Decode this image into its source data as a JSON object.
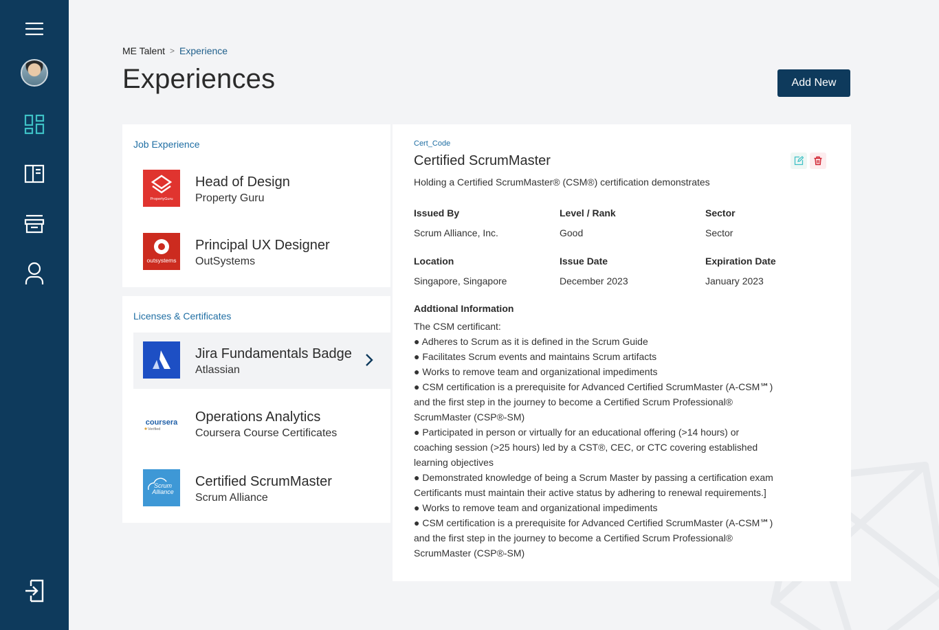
{
  "breadcrumb": {
    "root": "ME Talent",
    "separator": ">",
    "current": "Experience"
  },
  "page_title": "Experiences",
  "add_button": "Add New",
  "job_experience": {
    "heading": "Job Experience",
    "items": [
      {
        "title": "Head of Design",
        "subtitle": "Property Guru",
        "logo_text": "PropertyGuru",
        "logo_color": "#e0342f",
        "logo": "propertyguru-logo"
      },
      {
        "title": "Principal UX Designer",
        "subtitle": "OutSystems",
        "logo_text": "outsystems",
        "logo_color": "#cc2b1f",
        "logo": "outsystems-logo"
      }
    ]
  },
  "licenses": {
    "heading": "Licenses & Certificates",
    "items": [
      {
        "title": "Jira Fundamentals Badge",
        "subtitle": "Atlassian",
        "logo_color": "#1d4fc4",
        "logo": "atlassian-logo",
        "active": true
      },
      {
        "title": "Operations Analytics",
        "subtitle": "Coursera Course Certificates",
        "logo_text": "coursera",
        "logo_sub": "Verified",
        "logo_color": "#1f5fa8",
        "logo": "coursera-logo"
      },
      {
        "title": "Certified ScrumMaster",
        "subtitle": "Scrum Alliance",
        "logo_text": "Scrum Alliance",
        "logo_color": "#3e98d6",
        "logo": "scrum-alliance-logo"
      }
    ]
  },
  "detail": {
    "cert_code": "Cert_Code",
    "title": "Certified ScrumMaster",
    "description": "Holding a Certified ScrumMaster® (CSM®) certification demonstrates",
    "fields": [
      {
        "label": "Issued By",
        "value": "Scrum Alliance, Inc."
      },
      {
        "label": "Level / Rank",
        "value": "Good"
      },
      {
        "label": "Sector",
        "value": "Sector"
      },
      {
        "label": "Location",
        "value": "Singapore, Singapore"
      },
      {
        "label": "Issue Date",
        "value": "December 2023"
      },
      {
        "label": "Expiration Date",
        "value": "January 2023"
      }
    ],
    "additional_label": "Addtional Information",
    "additional_lines": [
      "The CSM certificant:",
      "● Adheres to Scrum as it is defined in the Scrum Guide",
      "● Facilitates Scrum events and maintains Scrum artifacts",
      "● Works to remove team and organizational impediments",
      "● CSM certification is a prerequisite for Advanced Certified ScrumMaster (A-CSM℠)",
      "and the first step in the journey to become a Certified Scrum Professional®",
      "ScrumMaster (CSP®-SM)",
      "● Participated in person or virtually for an educational offering (>14 hours) or",
      "coaching session (>25 hours) led by a CST®, CEC, or CTC covering established",
      "learning objectives",
      "● Demonstrated knowledge of being a Scrum Master by passing a certification exam",
      " Certificants must maintain their active status by adhering to renewal requirements.]",
      "● Works to remove team and organizational impediments",
      "● CSM certification is a prerequisite for Advanced Certified ScrumMaster (A-CSM℠)",
      "and the first step in the journey to become a Certified Scrum Professional®",
      "ScrumMaster (CSP®-SM)"
    ]
  },
  "colors": {
    "sidebar": "#0e3a5c",
    "accent": "#1f6ea3",
    "icon_active": "#3ec1c6",
    "delete": "#d0202e",
    "edit": "#3ec1c6"
  },
  "sidebar_icons": [
    "menu-icon",
    "avatar",
    "dashboard-icon",
    "book-icon",
    "store-icon",
    "user-icon",
    "logout-icon"
  ]
}
